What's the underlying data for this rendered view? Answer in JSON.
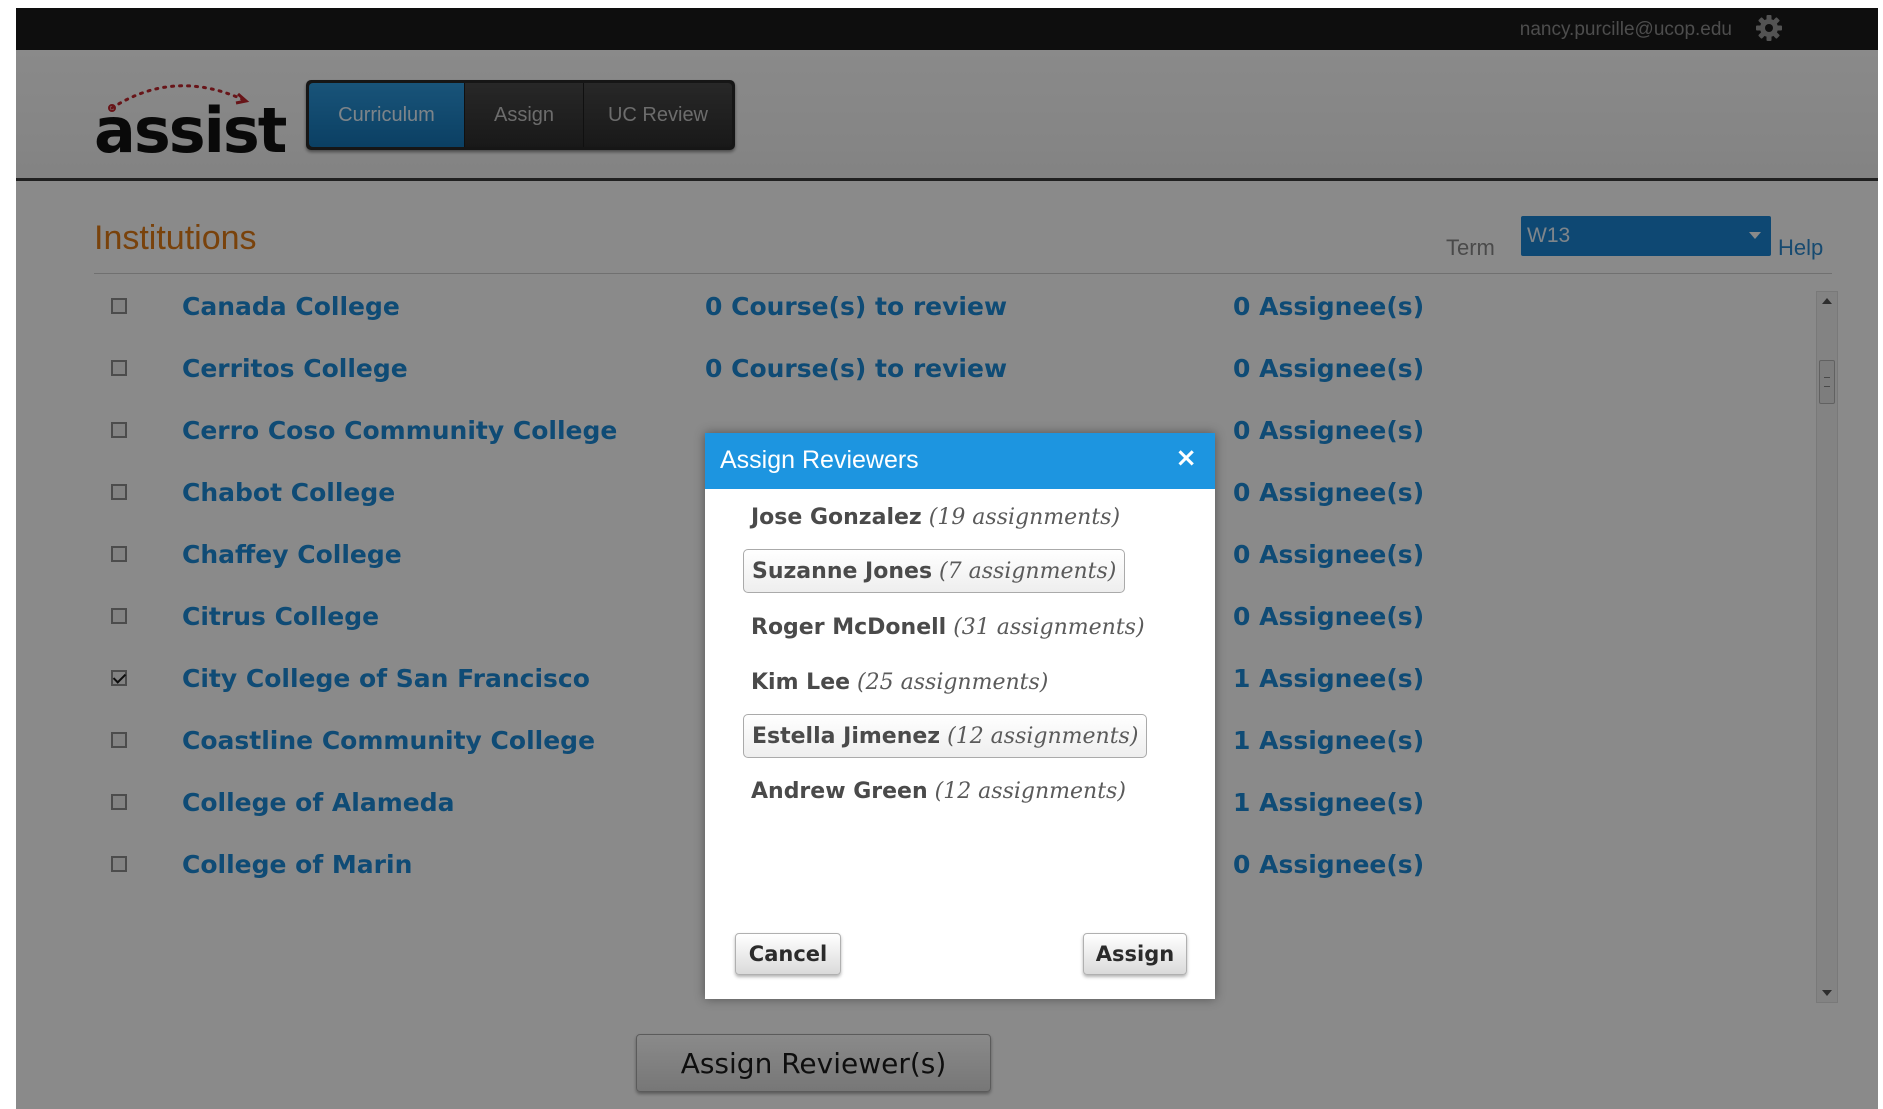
{
  "topbar": {
    "user_email": "nancy.purcille@ucop.edu",
    "settings_icon": "gear-icon"
  },
  "header": {
    "logo_text": "assist",
    "tabs": [
      {
        "label": "Curriculum",
        "active": true
      },
      {
        "label": "Assign",
        "active": false
      },
      {
        "label": "UC Review",
        "active": false
      }
    ]
  },
  "main": {
    "title": "Institutions",
    "term_label": "Term",
    "term_value": "W13",
    "help_label": "Help",
    "institutions": [
      {
        "name": "Canada College",
        "courses": "0 Course(s) to review",
        "assignees": "0 Assignee(s)",
        "checked": false
      },
      {
        "name": "Cerritos College",
        "courses": "0 Course(s) to review",
        "assignees": "0 Assignee(s)",
        "checked": false
      },
      {
        "name": "Cerro Coso Community College",
        "courses": "",
        "assignees": "0 Assignee(s)",
        "checked": false
      },
      {
        "name": "Chabot College",
        "courses": "",
        "assignees": "0 Assignee(s)",
        "checked": false
      },
      {
        "name": "Chaffey College",
        "courses": "",
        "assignees": "0 Assignee(s)",
        "checked": false
      },
      {
        "name": "Citrus College",
        "courses": "",
        "assignees": "0 Assignee(s)",
        "checked": false
      },
      {
        "name": "City College of San Francisco",
        "courses": "",
        "assignees": "1 Assignee(s)",
        "checked": true
      },
      {
        "name": "Coastline Community College",
        "courses": "",
        "assignees": "1 Assignee(s)",
        "checked": false
      },
      {
        "name": "College of Alameda",
        "courses": "",
        "assignees": "1 Assignee(s)",
        "checked": false
      },
      {
        "name": "College of Marin",
        "courses": "",
        "assignees": "0 Assignee(s)",
        "checked": false
      }
    ],
    "assign_button_label": "Assign Reviewer(s)"
  },
  "modal": {
    "title": "Assign Reviewers",
    "close_label": "×",
    "reviewers": [
      {
        "name": "Jose Gonzalez",
        "count": "(19 assignments)",
        "selected": false
      },
      {
        "name": "Suzanne Jones",
        "count": "(7 assignments)",
        "selected": true
      },
      {
        "name": "Roger McDonell",
        "count": "(31 assignments)",
        "selected": false
      },
      {
        "name": "Kim Lee",
        "count": "(25 assignments)",
        "selected": false
      },
      {
        "name": "Estella Jimenez",
        "count": "(12 assignments)",
        "selected": true
      },
      {
        "name": "Andrew Green",
        "count": "(12 assignments)",
        "selected": false
      }
    ],
    "cancel_label": "Cancel",
    "assign_label": "Assign"
  },
  "colors": {
    "accent_blue": "#1d95e0",
    "link_blue": "#1d8bd8",
    "title_orange": "#e07b16",
    "topbar_dark": "#1b1b1b"
  }
}
